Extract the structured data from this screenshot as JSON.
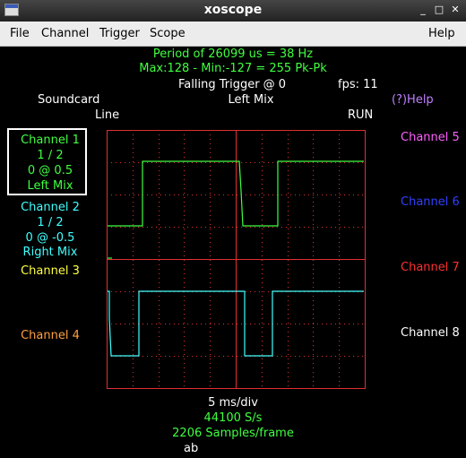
{
  "window": {
    "title": "xoscope",
    "minimize": "_",
    "maximize": "□",
    "close": "✕"
  },
  "menu": {
    "file": "File",
    "channel": "Channel",
    "trigger": "Trigger",
    "scope": "Scope",
    "help": "Help"
  },
  "status": {
    "period": "Period of  26099 us =     38 Hz",
    "maxmin": "Max:128 - Min:-127 = 255 Pk-Pk",
    "trigger": "Falling Trigger @ 0",
    "fps": "fps: 11",
    "source": "Soundcard",
    "trigger_source": "Left Mix",
    "help": "(?)Help",
    "line_mode": "Line",
    "run_state": "RUN"
  },
  "channels_left": {
    "ch1": {
      "name": "Channel 1",
      "scale": "1 / 2",
      "pos": "0 @ 0.5",
      "source": "Left Mix"
    },
    "ch2": {
      "name": "Channel 2",
      "scale": "1 / 2",
      "pos": "0 @ -0.5",
      "source": "Right Mix"
    },
    "ch3": {
      "name": "Channel 3"
    },
    "ch4": {
      "name": "Channel 4"
    }
  },
  "channels_right": {
    "ch5": "Channel 5",
    "ch6": "Channel 6",
    "ch7": "Channel 7",
    "ch8": "Channel 8"
  },
  "footer": {
    "timebase": "5 ms/div",
    "sample_rate": "44100 S/s",
    "samples": "2206 Samples/frame",
    "mode": "ab"
  },
  "colors": {
    "grid": "#e03030",
    "ch1": "#40ff40",
    "ch2": "#40ffff"
  },
  "traces": {
    "ch1_square": {
      "high_level": 0.5,
      "low_level": -0.5,
      "period_us": 26099
    },
    "ch2_square": {
      "high_level": 0.5,
      "low_level": -0.5,
      "period_us": 26099
    }
  }
}
